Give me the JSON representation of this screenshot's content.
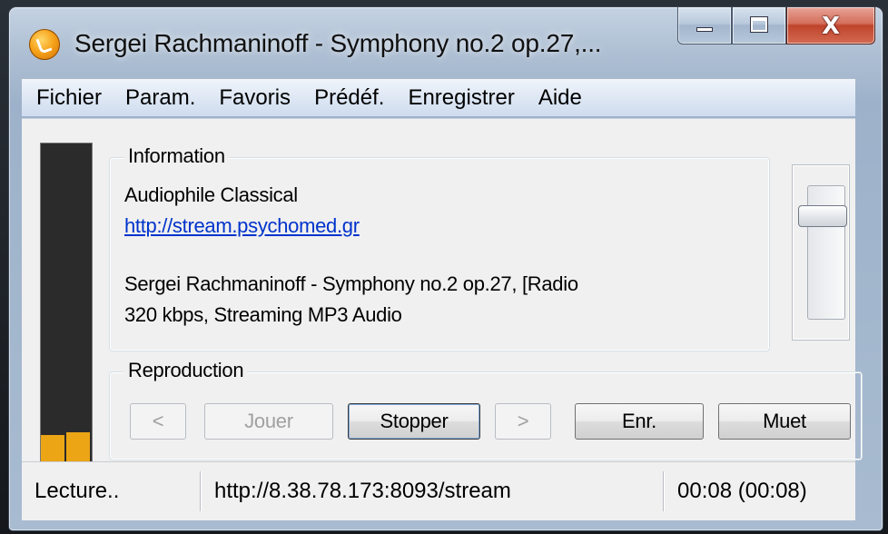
{
  "window": {
    "title": "Sergei Rachmaninoff - Symphony no.2 op.27,...",
    "app_icon": "radio-player-icon",
    "caption_buttons": {
      "minimize_icon": "minimize-icon",
      "maximize_icon": "maximize-icon",
      "close_glyph": "X"
    }
  },
  "menubar": {
    "items": [
      "Fichier",
      "Param.",
      "Favoris",
      "Prédéf.",
      "Enregistrer",
      "Aide"
    ]
  },
  "vu_meter": {
    "left_level": 0.088,
    "right_level": 0.098,
    "color": "#eba515"
  },
  "information": {
    "legend": "Information",
    "station_name": "Audiophile Classical",
    "station_url": "http://stream.psychomed.gr",
    "track_title": "Sergei Rachmaninoff - Symphony no.2 op.27, [Radio",
    "stream_info": "320 kbps, Streaming MP3 Audio"
  },
  "volume": {
    "level": 0.82
  },
  "reproduction": {
    "legend": "Reproduction",
    "prev_label": "<",
    "play_label": "Jouer",
    "stop_label": "Stopper",
    "next_label": ">",
    "record_label": "Enr.",
    "mute_label": "Muet"
  },
  "statusbar": {
    "state": "Lecture..",
    "stream_url": "http://8.38.78.173:8093/stream",
    "time": "00:08 (00:08)"
  }
}
